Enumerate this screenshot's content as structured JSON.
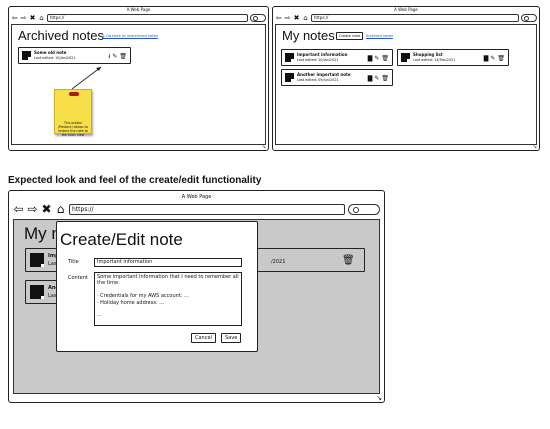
{
  "browser": {
    "title": "A Web Page",
    "url": "https://"
  },
  "archived": {
    "heading": "Archived notes",
    "back_link": "< Go back to unarchived notes",
    "note": {
      "title": "Some old note",
      "edited": "Last edited: 10/Jan/2021"
    },
    "sticky_note": "This button (Restore) allows to restore the note to the main view"
  },
  "main": {
    "heading": "My notes",
    "create_button": "Create note",
    "archived_link": "Archived notes",
    "notes": [
      {
        "title": "Important information",
        "edited": "Last edited: 10/Jan/2021"
      },
      {
        "title": "Shopping list",
        "edited": "Last edited: 14/Feb/2021"
      },
      {
        "title": "Another important note",
        "edited": "Last edited: 09/Jun/2021"
      }
    ]
  },
  "section_caption": "Expected look and feel of the create/edit functionality",
  "editor": {
    "bg_heading": "My n",
    "bg_note1_title": "Impo",
    "bg_note1_edited": "Last e",
    "bg_note2_title": "Anoth",
    "bg_note2_edited": "Last e",
    "bg_date_fragment": "/2021",
    "dialog_title": "Create/Edit note",
    "title_label": "Title",
    "title_value": "Important information",
    "content_label": "Content",
    "content_value": "Some important information that I need to remember all the time:\n\n    · Credentials for my AWS account: ...\n    · Holiday home address: ...\n\n...",
    "cancel_label": "Cancel",
    "save_label": "Save"
  },
  "icons": {
    "back": "arrow-left-icon",
    "forward": "arrow-right-icon",
    "stop": "close-icon",
    "home": "home-icon",
    "archive": "archive-icon",
    "edit": "pencil-icon",
    "delete": "trash-icon",
    "restore": "restore-icon"
  }
}
